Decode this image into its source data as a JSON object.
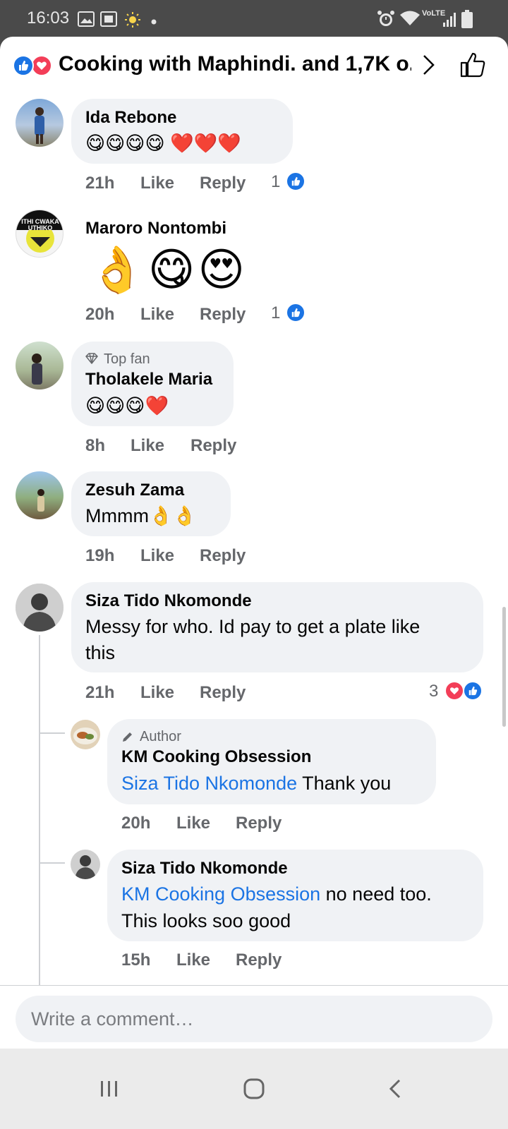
{
  "status_bar": {
    "time": "16:03",
    "left_icons": [
      "gallery-icon",
      "screenshot-icon",
      "sun-icon",
      "dot-icon"
    ],
    "right_icons": [
      "alarm-icon",
      "wifi-icon",
      "volte-icon",
      "signal-icon",
      "battery-icon"
    ],
    "volte_label": "VoLTE"
  },
  "header": {
    "title": "Cooking with Maphindi. and 1,7K o...",
    "reactions": [
      "like",
      "love"
    ]
  },
  "comments": [
    {
      "author": "Ida Rebone",
      "text": "😋😋😋😋 ❤️❤️❤️",
      "time": "21h",
      "like": "Like",
      "reply": "Reply",
      "reaction_count": "1"
    },
    {
      "author": "Maroro Nontombi",
      "text": "👌😋😍",
      "time": "20h",
      "like": "Like",
      "reply": "Reply",
      "reaction_count": "1",
      "avatar_text": "ITHI CWAKA UTHIKO"
    },
    {
      "badge": "Top fan",
      "author": "Tholakele Maria",
      "text": "😋😋😋❤️",
      "time": "8h",
      "like": "Like",
      "reply": "Reply"
    },
    {
      "author": "Zesuh Zama",
      "text": "Mmmm👌👌",
      "time": "19h",
      "like": "Like",
      "reply": "Reply"
    },
    {
      "author": "Siza Tido Nkomonde",
      "text_line1": "Messy for who. Id pay to get a plate like",
      "text_line2": "this",
      "time": "21h",
      "like": "Like",
      "reply": "Reply",
      "reaction_count": "3"
    }
  ],
  "replies": [
    {
      "badge": "Author",
      "author": "KM Cooking Obsession",
      "mention": "Siza Tido Nkomonde",
      "text": " Thank you",
      "time": "20h",
      "like": "Like",
      "reply": "Reply"
    },
    {
      "author": "Siza Tido Nkomonde",
      "mention": "KM Cooking Obsession",
      "text_line1": " no need too.",
      "text_line2": "This looks soo good",
      "time": "15h",
      "like": "Like",
      "reply": "Reply"
    }
  ],
  "composer": {
    "placeholder": "Write a comment…"
  },
  "colors": {
    "accent": "#1b74e4",
    "love": "#f33e58",
    "bubble": "#f0f2f5",
    "meta_text": "#65676b"
  }
}
